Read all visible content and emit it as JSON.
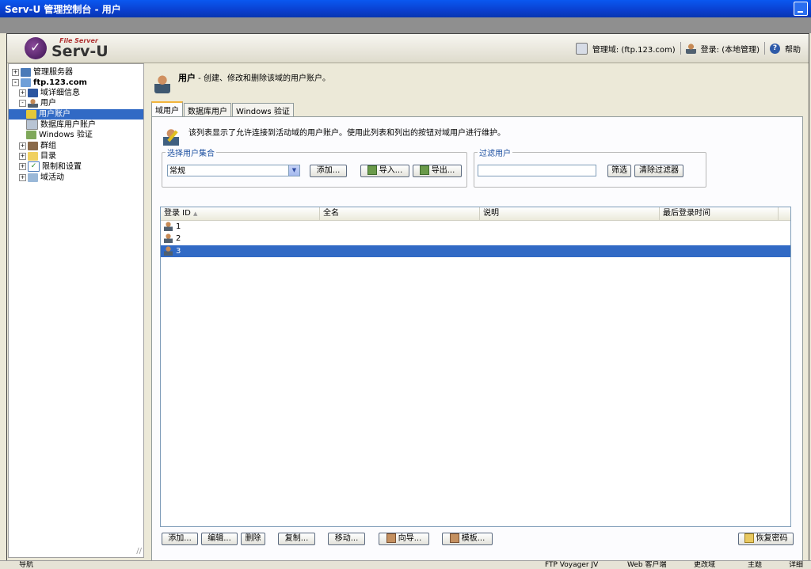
{
  "window": {
    "title": "Serv-U 管理控制台 - 用户"
  },
  "header": {
    "logo_small": "File Server",
    "logo_name": "Serv-U",
    "domain_label": "管理域: (ftp.123.com)",
    "login_label": "登录: (本地管理)",
    "help_label": "帮助"
  },
  "tree": {
    "items": [
      {
        "label": "管理服务器",
        "pm": "+"
      },
      {
        "label": "ftp.123.com",
        "pm": "-"
      },
      {
        "label": "域详细信息",
        "pm": "+"
      },
      {
        "label": "用户",
        "pm": "-"
      },
      {
        "label": "用户账户",
        "pm": ""
      },
      {
        "label": "数据库用户账户",
        "pm": ""
      },
      {
        "label": "Windows 验证",
        "pm": ""
      },
      {
        "label": "群组",
        "pm": "+"
      },
      {
        "label": "目录",
        "pm": "+"
      },
      {
        "label": "限制和设置",
        "pm": "+"
      },
      {
        "label": "域活动",
        "pm": "+"
      }
    ]
  },
  "page": {
    "title": "用户",
    "subtitle": " - 创建、修改和删除该域的用户账户。",
    "tabs": [
      "域用户",
      "数据库用户",
      "Windows 验证"
    ],
    "info": "该列表显示了允许连接到活动域的用户账户。使用此列表和列出的按钮对域用户进行维护。",
    "collection_legend": "选择用户集合",
    "collection_value": "常规",
    "add_collection": "添加...",
    "import": "导入...",
    "export": "导出...",
    "filter_legend": "过滤用户",
    "filter_btn": "筛选",
    "clear_filter": "清除过滤器"
  },
  "grid": {
    "columns": [
      "登录 ID",
      "全名",
      "说明",
      "最后登录时间"
    ],
    "sort_indicator": "▲",
    "rows": [
      "1",
      "2",
      "3"
    ]
  },
  "buttons": {
    "add": "添加...",
    "edit": "编辑...",
    "delete": "删除",
    "copy": "复制...",
    "move": "移动...",
    "wizard": "向导...",
    "template": "模板...",
    "recover": "恢复密码"
  },
  "statusbar": {
    "nav": "导航",
    "ftp": "FTP Voyager JV",
    "web": "Web 客户端",
    "change_domain": "更改域",
    "theme": "主题",
    "detail": "详细"
  }
}
